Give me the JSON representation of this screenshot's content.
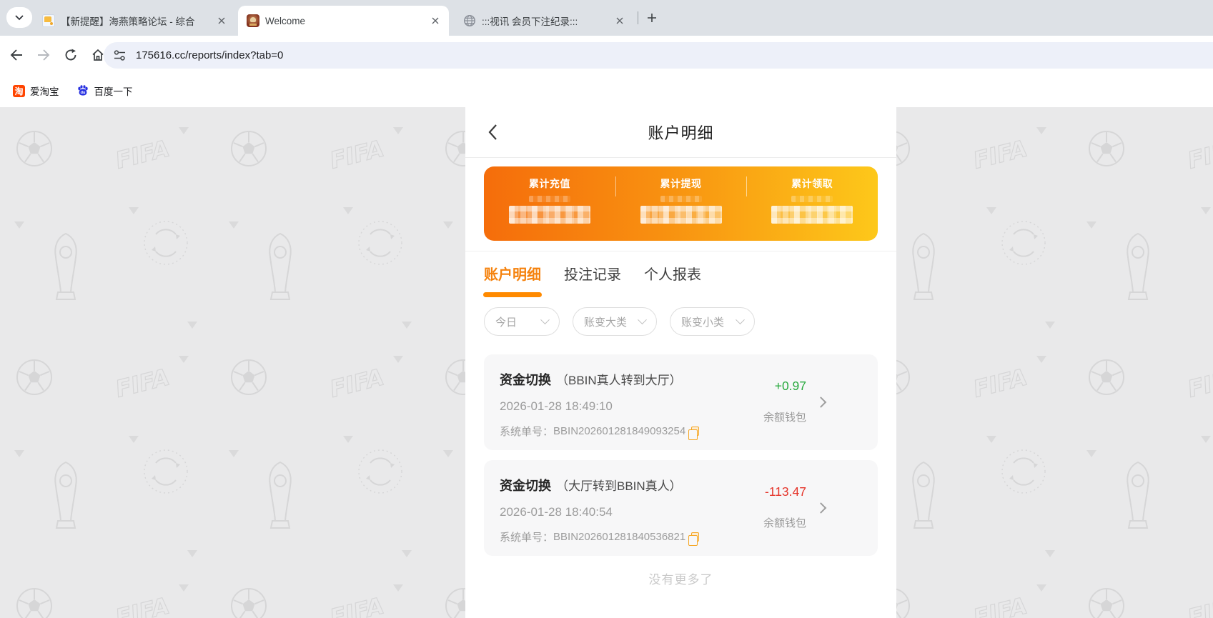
{
  "browser": {
    "tab_search_icon": "chevron-down-icon",
    "tabs": [
      {
        "title": "【新提醒】海燕策略论坛 - 综合",
        "icon": "forum-icon"
      },
      {
        "title": "Welcome",
        "icon": "casino-icon"
      },
      {
        "title": ":::视讯 会员下注纪录:::",
        "icon": "globe-icon"
      }
    ],
    "url": "175616.cc/reports/index?tab=0",
    "bookmarks": [
      {
        "label": "爱淘宝",
        "icon": "taobao-icon",
        "icon_glyph": "淘"
      },
      {
        "label": "百度一下",
        "icon": "baidu-paw-icon"
      }
    ]
  },
  "page": {
    "header": {
      "title": "账户明细"
    },
    "summary": {
      "items": [
        {
          "label": "累计充值",
          "value": "censored"
        },
        {
          "label": "累计提现",
          "value": "censored"
        },
        {
          "label": "累计领取",
          "value": "censored"
        }
      ],
      "gradient_start": "#f56d0b",
      "gradient_end": "#fdc81a"
    },
    "tabs": [
      {
        "label": "账户明细",
        "active": true
      },
      {
        "label": "投注记录",
        "active": false
      },
      {
        "label": "个人报表",
        "active": false
      }
    ],
    "filters": [
      {
        "label": "今日"
      },
      {
        "label": "账变大类"
      },
      {
        "label": "账变小类"
      }
    ],
    "transactions": [
      {
        "title": "资金切换",
        "subtitle": "（BBIN真人转到大厅）",
        "amount": "+0.97",
        "direction": "positive",
        "datetime": "2026-01-28 18:49:10",
        "order_label": "系统单号：",
        "order_no": "BBIN202601281849093254",
        "wallet": "余额钱包"
      },
      {
        "title": "资金切换",
        "subtitle": "（大厅转到BBIN真人）",
        "amount": "-113.47",
        "direction": "negative",
        "datetime": "2026-01-28 18:40:54",
        "order_label": "系统单号：",
        "order_no": "BBIN202601281840536821",
        "wallet": "余额钱包"
      }
    ],
    "footer": {
      "no_more": "没有更多了"
    },
    "colors": {
      "positive": "#27a93d",
      "negative": "#e5352b",
      "accent": "#ff8a00"
    }
  }
}
